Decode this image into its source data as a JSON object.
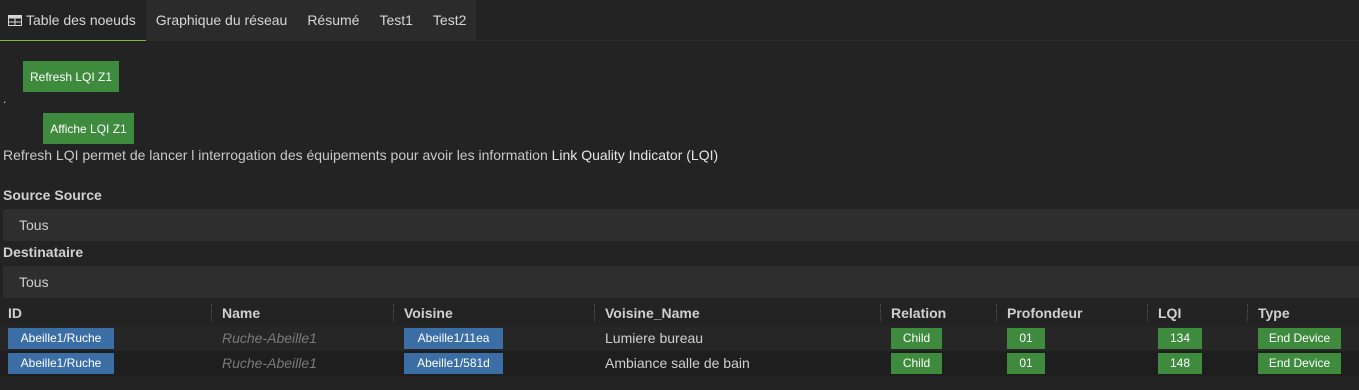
{
  "tabs": [
    {
      "label": "Table des noeuds",
      "icon": "table-icon",
      "active": true
    },
    {
      "label": "Graphique du réseau"
    },
    {
      "label": "Résumé"
    },
    {
      "label": "Test1"
    },
    {
      "label": "Test2"
    }
  ],
  "actions": {
    "refresh_label": "Refresh LQI Z1",
    "dot": ".",
    "show_label": "Affiche LQI Z1"
  },
  "info": {
    "text": "Refresh LQI permet de lancer l interrogation des équipements pour avoir les information ",
    "bold": "Link Quality Indicator (LQI)"
  },
  "filters": {
    "source_label": "Source Source",
    "source_value": "Tous",
    "dest_label": "Destinataire",
    "dest_value": "Tous"
  },
  "table": {
    "headers": [
      "ID",
      "Name",
      "Voisine",
      "Voisine_Name",
      "Relation",
      "Profondeur",
      "LQI",
      "Type"
    ],
    "rows": [
      {
        "id": "Abeille1/Ruche",
        "name": "Ruche-Abeille1",
        "voisine": "Abeille1/11ea",
        "voisine_name": "Lumiere bureau",
        "relation": "Child",
        "profondeur": "01",
        "lqi": "134",
        "type": "End Device"
      },
      {
        "id": "Abeille1/Ruche",
        "name": "Ruche-Abeille1",
        "voisine": "Abeille1/581d",
        "voisine_name": "Ambiance salle de bain",
        "relation": "Child",
        "profondeur": "01",
        "lqi": "148",
        "type": "End Device"
      }
    ]
  },
  "colors": {
    "accent_green": "#3e8b3e",
    "badge_blue": "#3a6ea5",
    "active_tab_underline": "#7dbb3c",
    "background": "#232323"
  }
}
